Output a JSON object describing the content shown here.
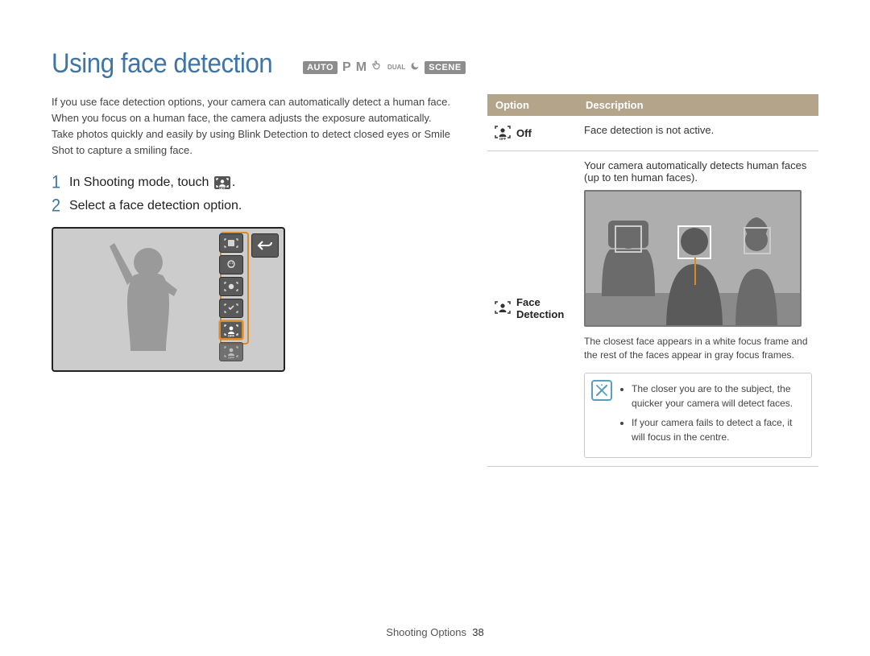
{
  "title": "Using face detection",
  "mode_badges": {
    "auto": "AUTO",
    "p": "P",
    "m": "M",
    "dual": "DUAL",
    "scene": "SCENE"
  },
  "intro": "If you use face detection options, your camera can automatically detect a human face. When you focus on a human face, the camera adjusts the exposure automatically. Take photos quickly and easily by using Blink Detection to detect closed eyes or Smile Shot to capture a smiling face.",
  "steps": {
    "s1_num": "1",
    "s1_pre": "In Shooting mode, touch",
    "s1_post": ".",
    "s2_num": "2",
    "s2_text": "Select a face detection option."
  },
  "table": {
    "header_option": "Option",
    "header_desc": "Description",
    "row1": {
      "label": "Off",
      "desc": "Face detection is not active."
    },
    "row2": {
      "label": "Face Detection",
      "desc_above": "Your camera automatically detects human faces (up to ten human faces).",
      "desc_below": "The closest face appears in a white focus frame and the rest of the faces appear in gray focus frames."
    }
  },
  "note": {
    "b1": "The closer you are to the subject, the quicker your camera will detect faces.",
    "b2": "If your camera fails to detect a face, it will focus in the centre."
  },
  "footer": {
    "section": "Shooting Options",
    "page": "38"
  }
}
